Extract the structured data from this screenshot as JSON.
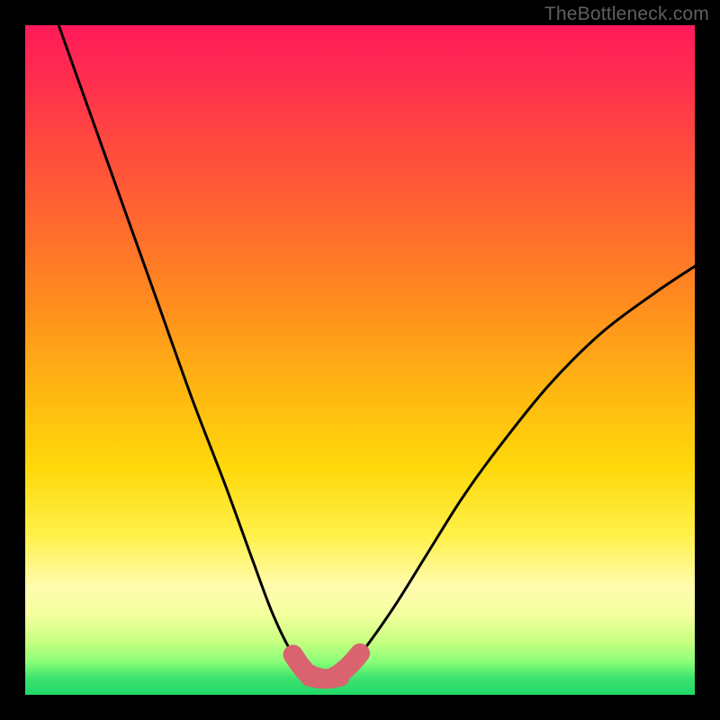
{
  "watermark": "TheBottleneck.com",
  "chart_data": {
    "type": "line",
    "title": "",
    "xlabel": "",
    "ylabel": "",
    "xlim": [
      0,
      100
    ],
    "ylim": [
      0,
      100
    ],
    "grid": false,
    "legend": false,
    "series": [
      {
        "name": "bottleneck-curve",
        "x": [
          5,
          10,
          15,
          20,
          25,
          30,
          34,
          37,
          40,
          42.5,
          45,
          47.5,
          50,
          55,
          60,
          65,
          70,
          78,
          86,
          94,
          100
        ],
        "y": [
          100,
          86,
          72,
          58,
          44,
          31,
          20,
          12,
          6,
          3.5,
          2.5,
          3.5,
          6,
          13,
          21,
          29,
          36,
          46,
          54,
          60,
          64
        ]
      },
      {
        "name": "highlight-band-left",
        "x": [
          40,
          41,
          42,
          43,
          44
        ],
        "y": [
          6.0,
          4.5,
          3.3,
          2.8,
          2.5
        ]
      },
      {
        "name": "highlight-band-right",
        "x": [
          46,
          47,
          48,
          49,
          50
        ],
        "y": [
          2.6,
          3.2,
          4.0,
          5.0,
          6.2
        ]
      },
      {
        "name": "highlight-band-bottom",
        "x": [
          42.5,
          44,
          45.5,
          47
        ],
        "y": [
          2.7,
          2.4,
          2.4,
          2.7
        ]
      }
    ],
    "colors": {
      "curve": "#000000",
      "highlight": "#d9636e"
    },
    "background_gradient": [
      {
        "stop": 0,
        "color": "#ff1a5a"
      },
      {
        "stop": 18,
        "color": "#ff4a3e"
      },
      {
        "stop": 42,
        "color": "#ff8e1e"
      },
      {
        "stop": 66,
        "color": "#ffd80a"
      },
      {
        "stop": 84,
        "color": "#fffcb0"
      },
      {
        "stop": 95,
        "color": "#8cff78"
      },
      {
        "stop": 100,
        "color": "#22d96a"
      }
    ]
  }
}
